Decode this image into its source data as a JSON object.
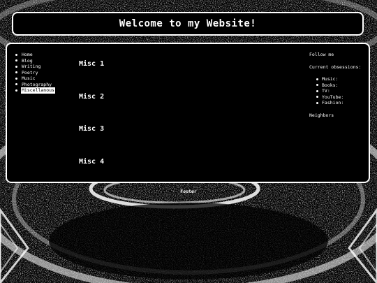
{
  "header": {
    "title": "Welcome to my Website!"
  },
  "nav": {
    "items": [
      {
        "label": "Home",
        "active": false
      },
      {
        "label": "Blog",
        "active": false
      },
      {
        "label": "Writing",
        "active": false
      },
      {
        "label": "Poetry",
        "active": false
      },
      {
        "label": "Music",
        "active": false
      },
      {
        "label": "Photography",
        "active": false
      },
      {
        "label": "Miscellanous",
        "active": true
      }
    ]
  },
  "content": {
    "sections": [
      {
        "title": "Misc 1"
      },
      {
        "title": "Misc 2"
      },
      {
        "title": "Misc 3"
      },
      {
        "title": "Misc 4"
      }
    ]
  },
  "aside": {
    "follow_label": "Follow me",
    "obsessions_label": "Current obsessions:",
    "obsessions": [
      "Music:",
      "Books:",
      "TV:",
      "YouTube:",
      "Fashion:"
    ],
    "neighbors_label": "Neighbors"
  },
  "footer": {
    "text": "Footer"
  },
  "colors": {
    "background": "#000000",
    "foreground": "#ffffff",
    "border": "#ffffff"
  }
}
